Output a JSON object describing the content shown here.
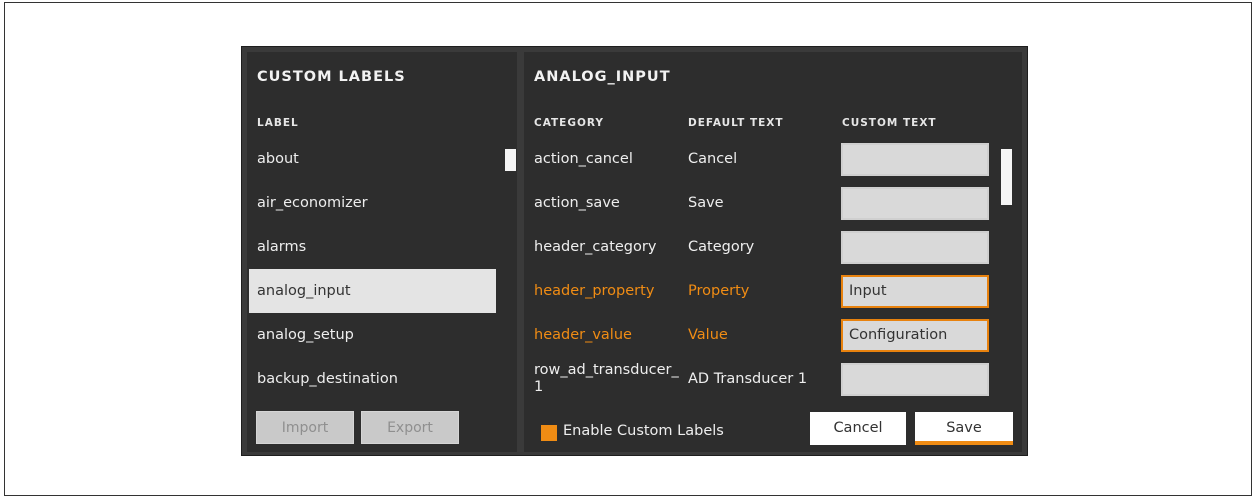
{
  "left": {
    "title": "CUSTOM LABELS",
    "column_header": "LABEL",
    "items": [
      {
        "label": "about"
      },
      {
        "label": "air_economizer"
      },
      {
        "label": "alarms"
      },
      {
        "label": "analog_input",
        "selected": true
      },
      {
        "label": "analog_setup"
      },
      {
        "label": "backup_destination"
      }
    ],
    "import_label": "Import",
    "export_label": "Export"
  },
  "right": {
    "title": "ANALOG_INPUT",
    "headers": {
      "category": "CATEGORY",
      "default_text": "DEFAULT TEXT",
      "custom_text": "CUSTOM TEXT"
    },
    "rows": [
      {
        "category": "action_cancel",
        "default": "Cancel",
        "custom": "",
        "highlighted": false
      },
      {
        "category": "action_save",
        "default": "Save",
        "custom": "",
        "highlighted": false
      },
      {
        "category": "header_category",
        "default": "Category",
        "custom": "",
        "highlighted": false
      },
      {
        "category": "header_property",
        "default": "Property",
        "custom": "Input",
        "highlighted": true
      },
      {
        "category": "header_value",
        "default": "Value",
        "custom": "Configuration",
        "highlighted": true
      },
      {
        "category": "row_ad_transducer_1",
        "default": "AD Transducer 1",
        "custom": "",
        "highlighted": false
      }
    ],
    "enable_label": "Enable Custom Labels",
    "cancel_label": "Cancel",
    "save_label": "Save"
  },
  "colors": {
    "accent": "#f08c14",
    "panel": "#2d2d2d",
    "frame": "#3a3a3a"
  }
}
